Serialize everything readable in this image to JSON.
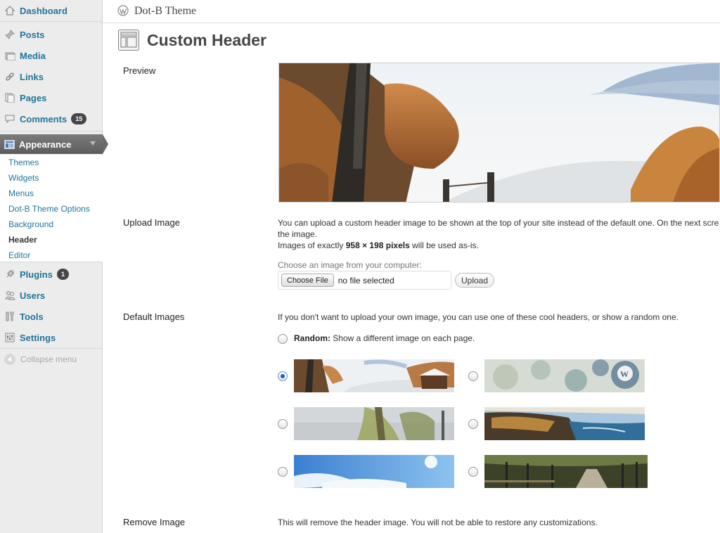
{
  "sidebar": {
    "dashboard": "Dashboard",
    "posts": "Posts",
    "media": "Media",
    "links": "Links",
    "pages": "Pages",
    "comments": "Comments",
    "comments_count": "15",
    "appearance": "Appearance",
    "submenu": [
      "Themes",
      "Widgets",
      "Menus",
      "Dot-B Theme Options",
      "Background",
      "Header",
      "Editor"
    ],
    "current_submenu": "Header",
    "plugins": "Plugins",
    "plugins_count": "1",
    "users": "Users",
    "tools": "Tools",
    "settings": "Settings",
    "collapse": "Collapse menu"
  },
  "site": {
    "title": "Dot-B Theme"
  },
  "page": {
    "title": "Custom Header"
  },
  "labels": {
    "preview": "Preview",
    "upload_image": "Upload Image",
    "default_images": "Default Images",
    "remove_image": "Remove Image"
  },
  "upload": {
    "desc_line1": "You can upload a custom header image to be shown at the top of your site instead of the default one. On the next scre",
    "desc_line2": "the image.",
    "size_prefix": "Images of exactly ",
    "size_value": "958 × 198 pixels",
    "size_suffix": " will be used as-is.",
    "choose_label": "Choose an image from your computer:",
    "choose_button": "Choose File",
    "file_status": "no file selected",
    "upload_button": "Upload"
  },
  "defaults": {
    "intro": "If you don't want to upload your own image, you can use one of these cool headers, or show a random one.",
    "random_label": "Random:",
    "random_desc": " Show a different image on each page.",
    "selected": "winter-cabin",
    "options": [
      "winter-cabin",
      "watercolor",
      "willow",
      "coast",
      "sky",
      "tree-lane"
    ]
  },
  "remove": {
    "desc": "This will remove the header image. You will not be able to restore any customizations."
  },
  "colors": {
    "link": "#21759b",
    "sidebar_bg": "#ececec",
    "active_menu": "#6b6b6b"
  }
}
